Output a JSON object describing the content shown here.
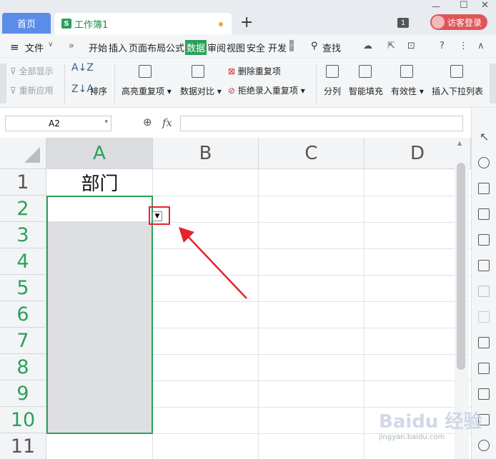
{
  "tabs": {
    "home": "首页",
    "workbook": "工作簿1",
    "workbook_icon": "S"
  },
  "titlebar": {
    "badge": "1",
    "login": "访客登录"
  },
  "menu": {
    "file": "文件",
    "items": [
      "开始",
      "插入",
      "页面布局",
      "公式",
      "数据",
      "审阅",
      "视图",
      "安全",
      "开发"
    ],
    "active": "数据",
    "search": "查找"
  },
  "ribbon": {
    "show_all": "全部显示",
    "reapply": "重新应用",
    "sort": "排序",
    "highlight_dup": "高亮重复项",
    "compare": "数据对比",
    "remove_dup": "删除重复项",
    "reject_dup": "拒绝录入重复项",
    "split": "分列",
    "smart_fill": "智能填充",
    "validity": "有效性",
    "insert_dropdown": "插入下拉列表"
  },
  "formula_bar": {
    "name_box": "A2",
    "fx": "fx",
    "value": ""
  },
  "columns": [
    "A",
    "B",
    "C",
    "D"
  ],
  "rows": [
    "1",
    "2",
    "3",
    "4",
    "5",
    "6",
    "7",
    "8",
    "9",
    "10",
    "11"
  ],
  "cells": {
    "A1": "部门"
  },
  "colors": {
    "accent": "#2aa15a",
    "highlight": "#e3242b",
    "tab_home": "#5b8de8",
    "login": "#e0555a"
  },
  "watermark": {
    "text": "Baidu 经验",
    "url": "jingyan.baidu.com"
  }
}
